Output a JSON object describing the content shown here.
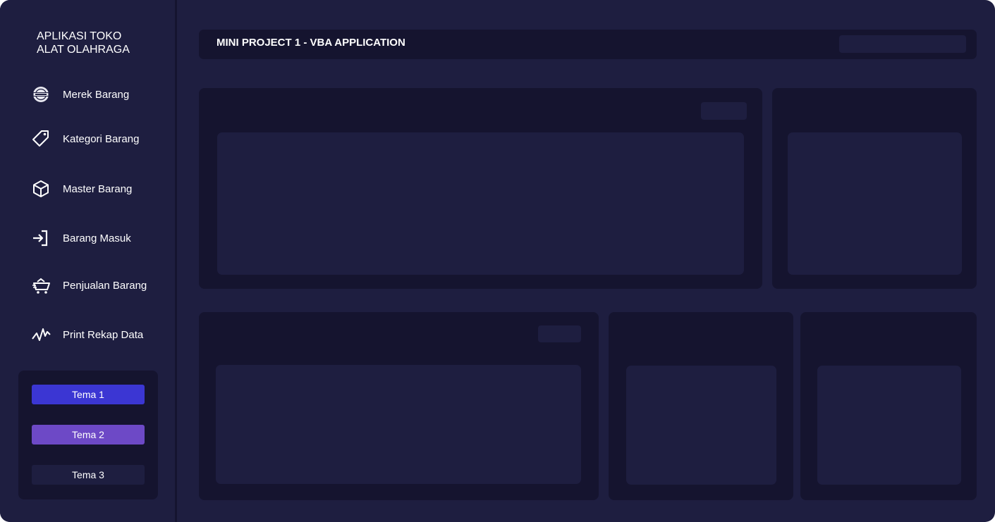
{
  "sidebar": {
    "app_title": "APLIKASI TOKO\nALAT OLAHRAGA",
    "items": [
      {
        "label": "Merek Barang",
        "icon": "brand-badge-icon"
      },
      {
        "label": "Kategori Barang",
        "icon": "tag-icon"
      },
      {
        "label": "Master Barang",
        "icon": "box-icon"
      },
      {
        "label": "Barang Masuk",
        "icon": "sign-in-icon"
      },
      {
        "label": "Penjualan Barang",
        "icon": "shopping-cart-icon"
      },
      {
        "label": "Print Rekap Data",
        "icon": "activity-chart-icon"
      }
    ],
    "themes": [
      {
        "label": "Tema 1",
        "color": "#3b36d3"
      },
      {
        "label": "Tema 2",
        "color": "#6d49c6"
      },
      {
        "label": "Tema 3",
        "color": "#1e1e40"
      }
    ]
  },
  "header": {
    "title": "MINI PROJECT 1 - VBA APPLICATION",
    "search_placeholder": ""
  },
  "colors": {
    "background": "#1e1e40",
    "panel": "#15142f",
    "text": "#ffffff"
  }
}
